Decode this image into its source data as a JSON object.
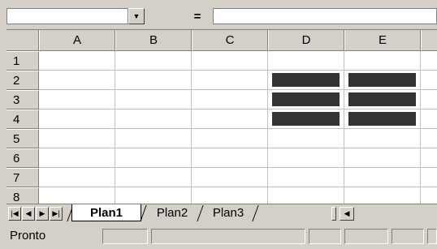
{
  "formula_bar": {
    "name_box_value": "",
    "dropdown_glyph": "▼",
    "equals_label": "=",
    "formula_value": ""
  },
  "grid": {
    "columns": [
      "A",
      "B",
      "C",
      "D",
      "E"
    ],
    "rows": [
      "1",
      "2",
      "3",
      "4",
      "5",
      "6",
      "7",
      "8"
    ],
    "filled_cells": [
      "D2",
      "E2",
      "D3",
      "E3",
      "D4",
      "E4"
    ],
    "filled_color": "#333333"
  },
  "sheet_nav": {
    "first_glyph": "|◀",
    "prev_glyph": "◀",
    "next_glyph": "▶",
    "last_glyph": "▶|"
  },
  "sheet_tabs": [
    "Plan1",
    "Plan2",
    "Plan3"
  ],
  "active_sheet": "Plan1",
  "hscroll": {
    "left_glyph": "◀"
  },
  "status": {
    "text": "Pronto"
  }
}
